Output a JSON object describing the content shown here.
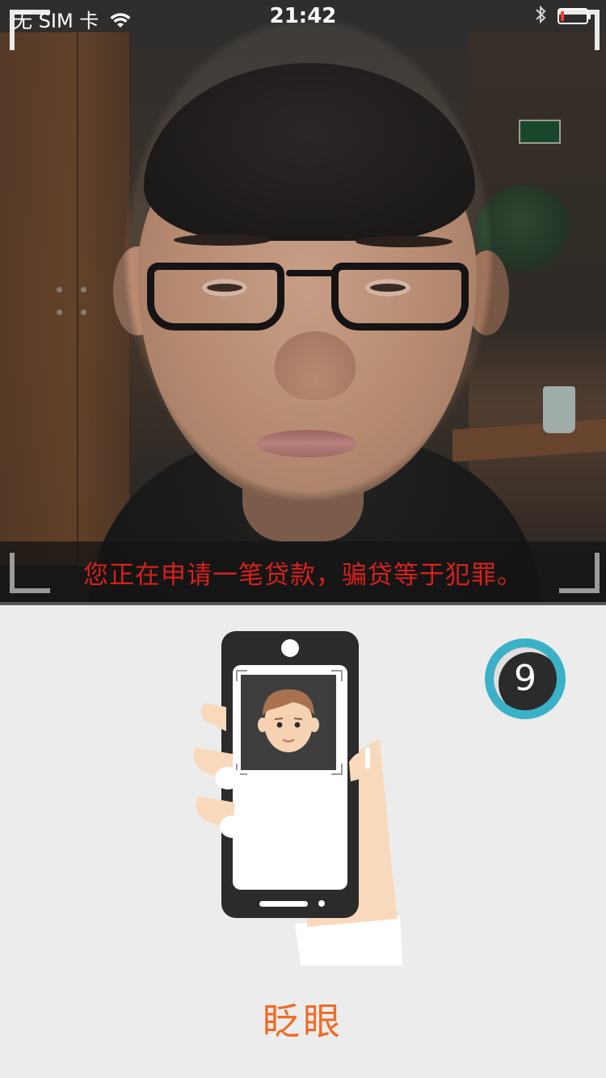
{
  "status_bar": {
    "carrier": "无 SIM 卡",
    "time": "21:42",
    "battery_level": 0.15,
    "battery_color": "#ff3b30"
  },
  "camera": {
    "warning": "您正在申请一笔贷款，骗贷等于犯罪。",
    "warning_color": "#d4221b",
    "icons": [
      "wifi-icon",
      "bluetooth-icon",
      "battery-icon",
      "corner-bracket-icon"
    ]
  },
  "instruction": {
    "countdown": "9",
    "countdown_ring_color": "#3bb1c8",
    "action": "眨眼",
    "action_color": "#ee6c24",
    "illustration": "hand-holding-phone-with-face"
  }
}
